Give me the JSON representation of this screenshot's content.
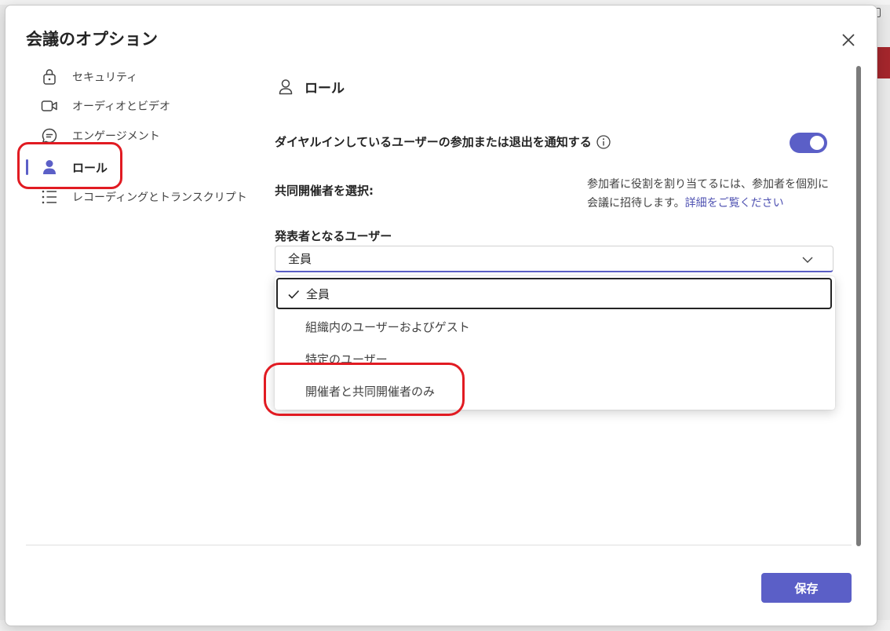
{
  "dialog": {
    "title": "会議のオプション",
    "close_icon": "close-icon"
  },
  "nav": {
    "items": [
      {
        "label": "セキュリティ",
        "icon": "lock-icon"
      },
      {
        "label": "オーディオとビデオ",
        "icon": "video-camera-icon"
      },
      {
        "label": "エンゲージメント",
        "icon": "chat-bubble-icon"
      },
      {
        "label": "ロール",
        "icon": "person-icon",
        "active": true
      },
      {
        "label": "レコーディングとトランスクリプト",
        "icon": "list-icon"
      }
    ]
  },
  "main": {
    "section_title": "ロール",
    "notify_toggle": {
      "label": "ダイヤルインしているユーザーの参加または退出を通知する",
      "enabled": true
    },
    "cohost": {
      "label": "共同開催者を選択:",
      "help_text": "参加者に役割を割り当てるには、参加者を個別に会議に招待します。",
      "help_link": "詳細をご覧ください"
    },
    "presenters": {
      "label": "発表者となるユーザー",
      "selected_value": "全員",
      "options": [
        "全員",
        "組織内のユーザーおよびゲスト",
        "特定のユーザー",
        "開催者と共同開催者のみ"
      ]
    }
  },
  "footer": {
    "save_label": "保存"
  },
  "colors": {
    "accent": "#5b5fc7",
    "highlight": "#e11b22"
  }
}
